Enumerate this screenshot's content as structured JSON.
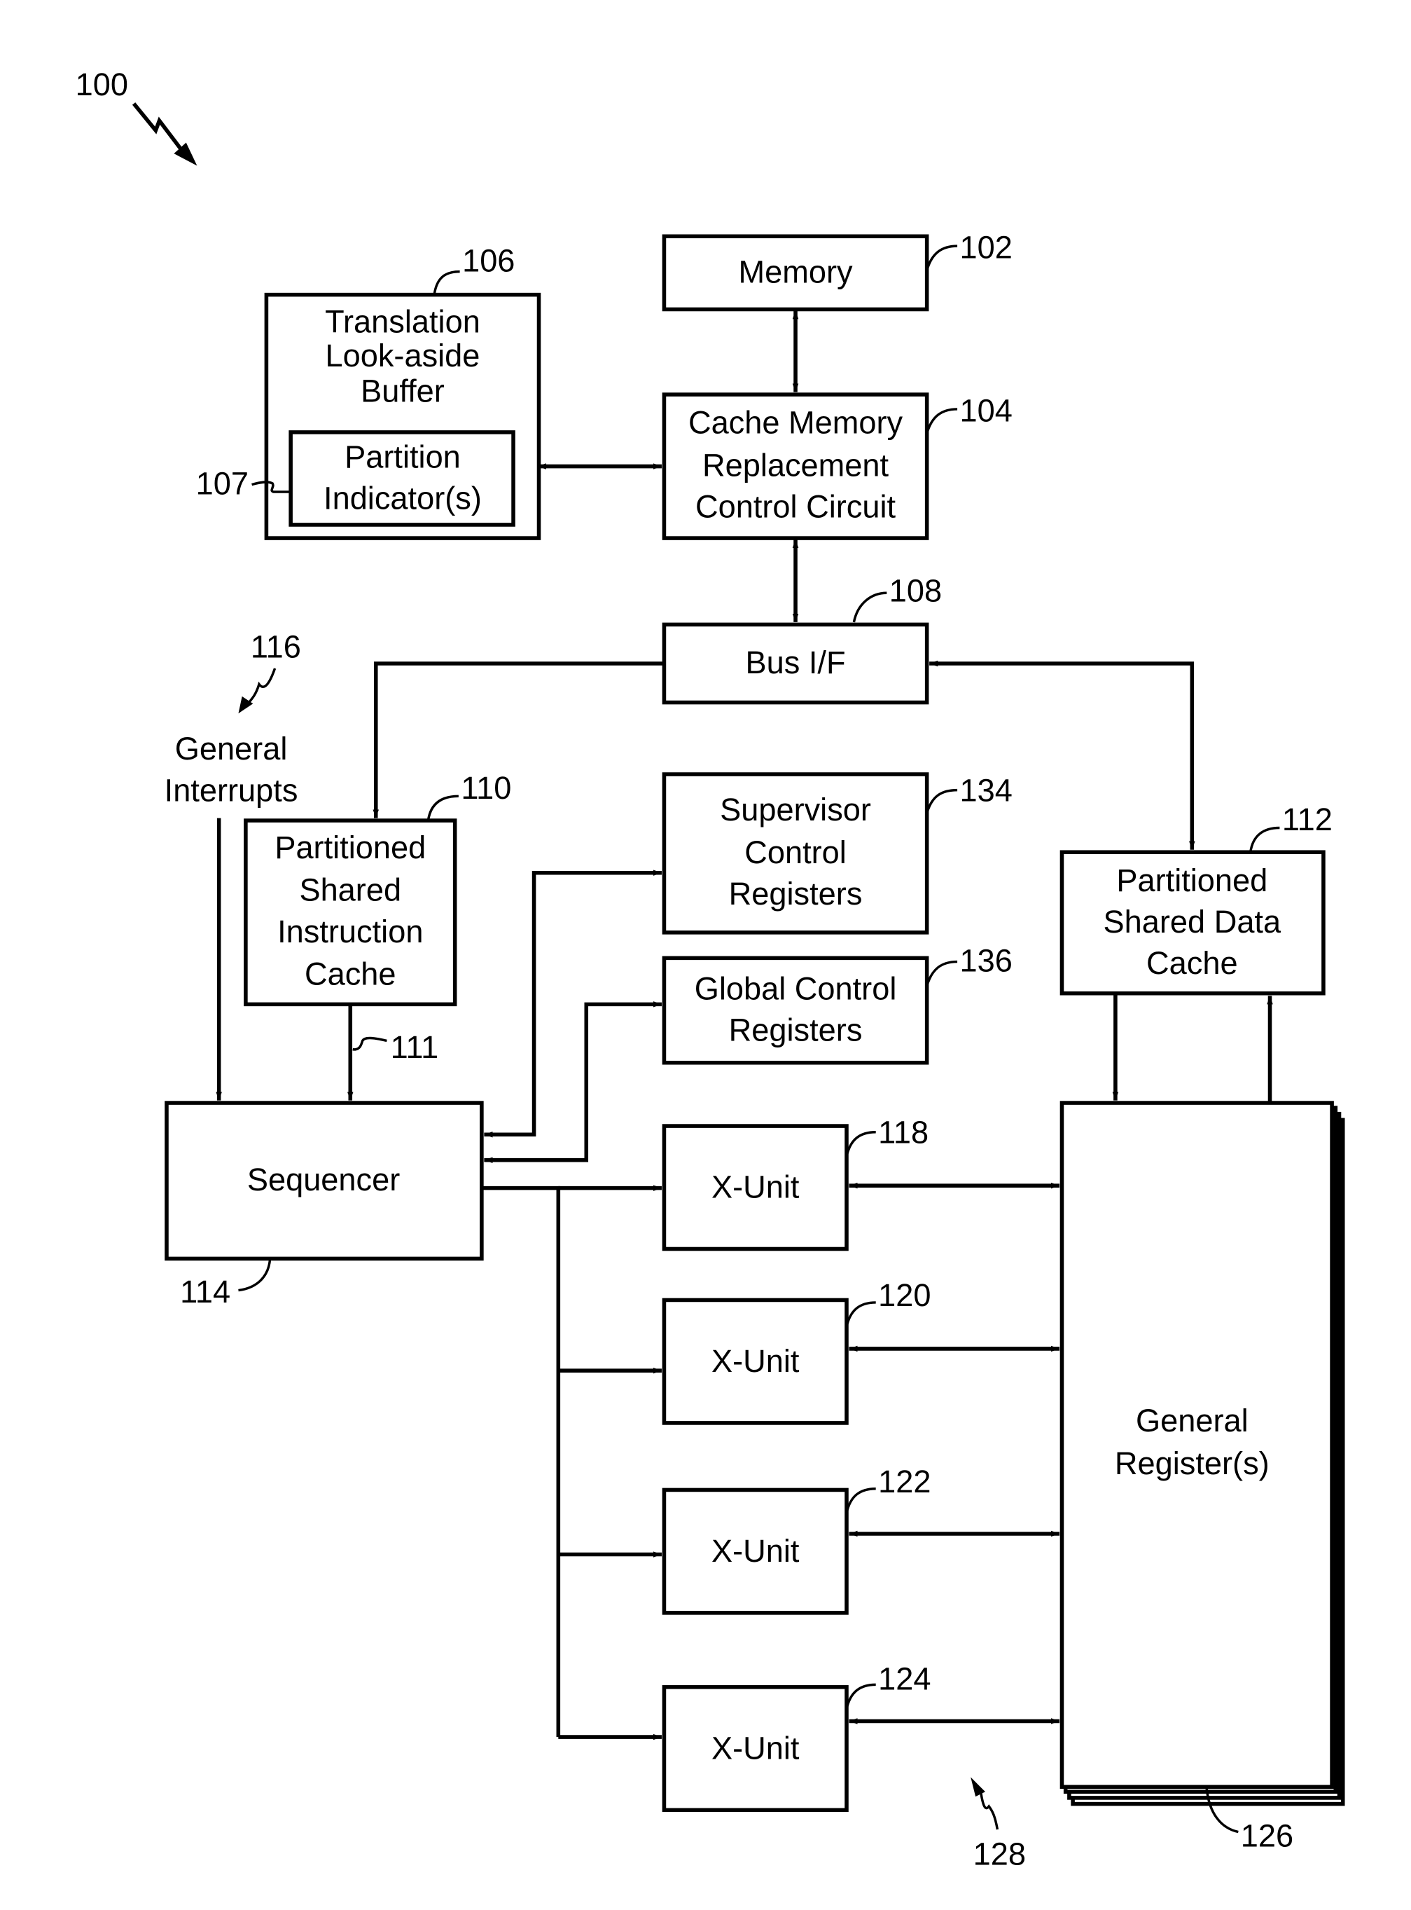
{
  "figure": {
    "ref": "100",
    "ink_color": "#000000",
    "background_color": "#ffffff"
  },
  "blocks": {
    "memory": {
      "ref": "102",
      "lines": [
        "Memory"
      ]
    },
    "cache_control": {
      "ref": "104",
      "lines": [
        "Cache Memory",
        "Replacement",
        "Control Circuit"
      ]
    },
    "tlb": {
      "ref": "106",
      "lines": [
        "Translation",
        "Look-aside",
        "Buffer"
      ]
    },
    "partition_indicators": {
      "ref": "107",
      "lines": [
        "Partition",
        "Indicator(s)"
      ]
    },
    "bus_if": {
      "ref": "108",
      "lines": [
        "Bus I/F"
      ]
    },
    "instruction_cache": {
      "ref": "110",
      "lines": [
        "Partitioned",
        "Shared",
        "Instruction",
        "Cache"
      ]
    },
    "instruction_path": {
      "ref": "111"
    },
    "data_cache": {
      "ref": "112",
      "lines": [
        "Partitioned",
        "Shared Data",
        "Cache"
      ]
    },
    "sequencer": {
      "ref": "114",
      "lines": [
        "Sequencer"
      ]
    },
    "general_interrupts": {
      "ref": "116",
      "lines": [
        "General",
        "Interrupts"
      ]
    },
    "supervisor_regs": {
      "ref": "134",
      "lines": [
        "Supervisor",
        "Control",
        "Registers"
      ]
    },
    "global_regs": {
      "ref": "136",
      "lines": [
        "Global Control",
        "Registers"
      ]
    },
    "general_registers": {
      "ref": "126",
      "lines": [
        "General",
        "Register(s)"
      ]
    },
    "x_units": [
      {
        "ref": "118",
        "label": "X-Unit"
      },
      {
        "ref": "120",
        "label": "X-Unit"
      },
      {
        "ref": "122",
        "label": "X-Unit"
      },
      {
        "ref": "124",
        "label": "X-Unit"
      }
    ],
    "execution_group": {
      "ref": "128"
    }
  }
}
